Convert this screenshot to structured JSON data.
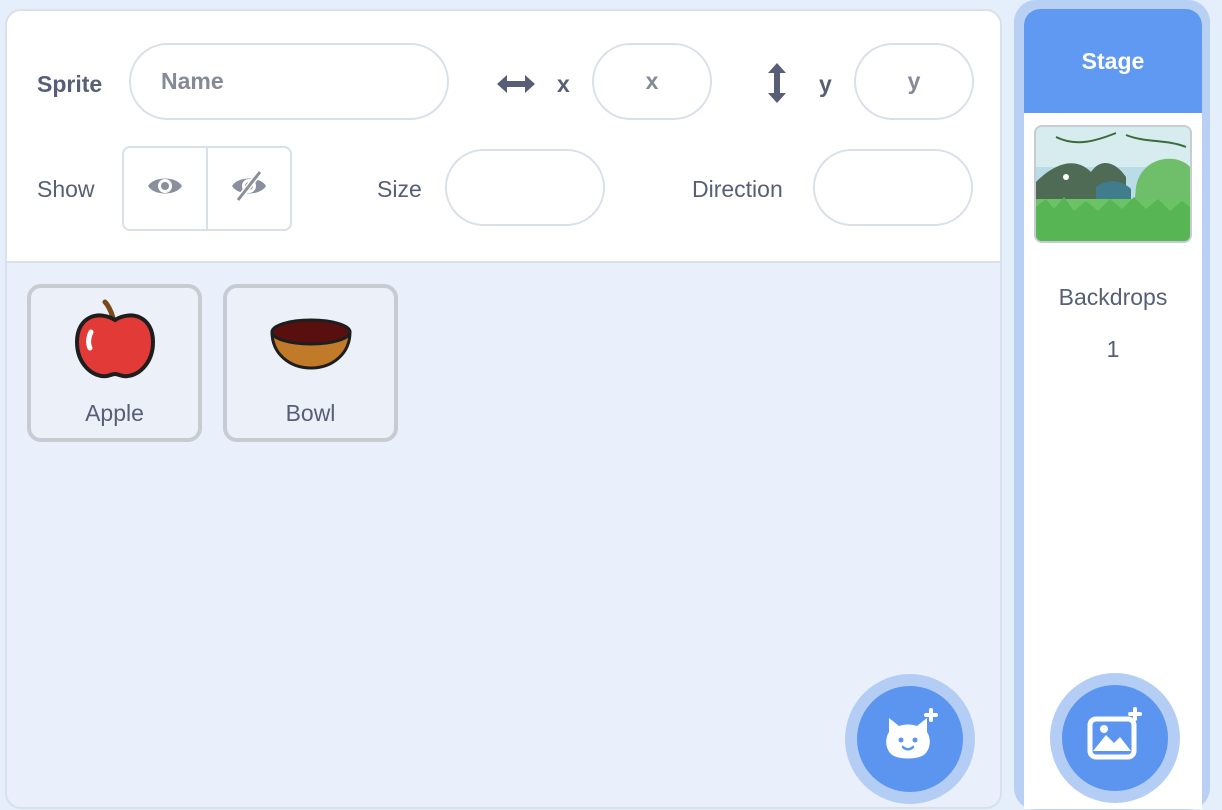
{
  "sprite_info": {
    "sprite_label": "Sprite",
    "name_placeholder": "Name",
    "x_label": "x",
    "x_placeholder": "x",
    "y_label": "y",
    "y_placeholder": "y",
    "show_label": "Show",
    "size_label": "Size",
    "size_value": "",
    "direction_label": "Direction",
    "direction_value": ""
  },
  "sprites": [
    {
      "name": "Apple",
      "icon": "apple-icon"
    },
    {
      "name": "Bowl",
      "icon": "bowl-icon"
    }
  ],
  "stage": {
    "header": "Stage",
    "backdrops_label": "Backdrops",
    "backdrops_count": "1"
  },
  "buttons": {
    "choose_sprite_icon": "cat-plus-icon",
    "choose_backdrop_icon": "image-plus-icon"
  },
  "colors": {
    "accent": "#5c95f0",
    "accent_ring": "#b4cdf5",
    "text": "#575e75"
  }
}
